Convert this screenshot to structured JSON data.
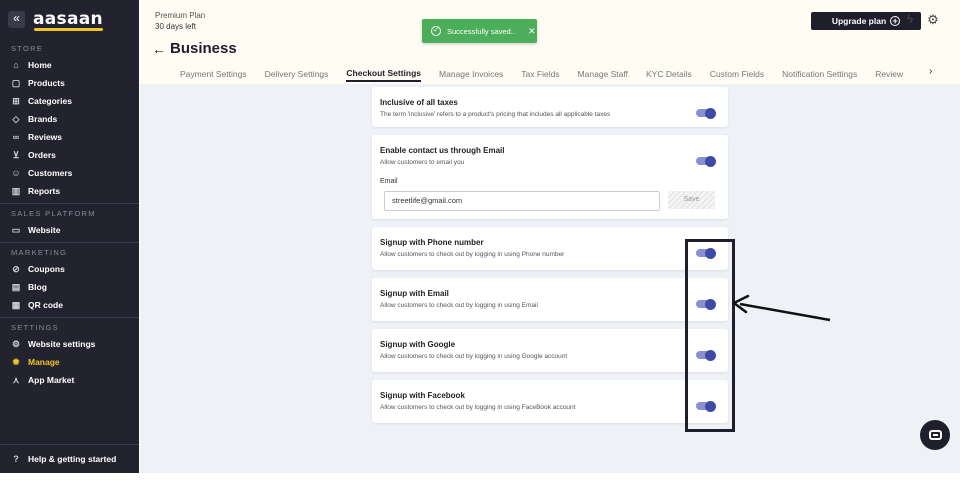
{
  "sidebar": {
    "collapse_icon": "«",
    "logo": "aasaan",
    "sections": [
      {
        "label": "STORE",
        "items": [
          {
            "label": "Home",
            "icon": "home-icon",
            "glyph": "⌂"
          },
          {
            "label": "Products",
            "icon": "products-icon",
            "glyph": "▢"
          },
          {
            "label": "Categories",
            "icon": "categories-icon",
            "glyph": "⊞"
          },
          {
            "label": "Brands",
            "icon": "tag-icon",
            "glyph": "◇"
          },
          {
            "label": "Reviews",
            "icon": "link-icon",
            "glyph": "∞"
          },
          {
            "label": "Orders",
            "icon": "cart-icon",
            "glyph": "⊻"
          },
          {
            "label": "Customers",
            "icon": "users-icon",
            "glyph": "☺"
          },
          {
            "label": "Reports",
            "icon": "bar-chart-icon",
            "glyph": "▥"
          }
        ]
      },
      {
        "label": "SALES PLATFORM",
        "items": [
          {
            "label": "Website",
            "icon": "monitor-icon",
            "glyph": "▭"
          }
        ]
      },
      {
        "label": "MARKETING",
        "items": [
          {
            "label": "Coupons",
            "icon": "coupon-icon",
            "glyph": "⊘"
          },
          {
            "label": "Blog",
            "icon": "blog-icon",
            "glyph": "▤"
          },
          {
            "label": "QR code",
            "icon": "qr-icon",
            "glyph": "▦"
          }
        ]
      },
      {
        "label": "SETTINGS",
        "items": [
          {
            "label": "Website settings",
            "icon": "website-settings-icon",
            "glyph": "⚙"
          },
          {
            "label": "Manage",
            "icon": "gear-icon",
            "glyph": "✹",
            "active": true
          },
          {
            "label": "App Market",
            "icon": "app-market-icon",
            "glyph": "⋏"
          }
        ]
      }
    ],
    "help": {
      "label": "Help & getting started",
      "icon": "help-icon",
      "glyph": "?"
    }
  },
  "header": {
    "plan": "Premium Plan",
    "days_left": "30 days left",
    "upgrade_label": "Upgrade plan",
    "page_title": "Business",
    "tabs": [
      "Payment Settings",
      "Delivery Settings",
      "Checkout Settings",
      "Manage Invoices",
      "Tax Fields",
      "Manage Staff",
      "KYC Details",
      "Custom Fields",
      "Notification Settings",
      "Review"
    ],
    "active_tab": "Checkout Settings"
  },
  "toast": {
    "message": "Successfully saved.."
  },
  "settings": {
    "taxes": {
      "title": "Inclusive of all taxes",
      "desc": "The term 'inclusive' refers to a product's pricing that includes all applicable taxes",
      "enabled": true
    },
    "contact_email": {
      "title": "Enable contact us through Email",
      "desc": "Allow customers to email you",
      "enabled": true,
      "email_label": "Email",
      "email_value": "streetlife@gmail.com",
      "save_label": "Save"
    },
    "signup_phone": {
      "title": "Signup with Phone number",
      "desc": "Allow customers to check out by logging in using Phone number",
      "enabled": true
    },
    "signup_email": {
      "title": "Signup with Email",
      "desc": "Allow customers to check out by logging in using Email",
      "enabled": true
    },
    "signup_google": {
      "title": "Signup with Google",
      "desc": "Allow customers to check out by logging in using Google account",
      "enabled": true
    },
    "signup_facebook": {
      "title": "Signup with Facebook",
      "desc": "Allow customers to check out by logging in using FaceBook account",
      "enabled": true
    }
  },
  "colors": {
    "sidebar_bg": "#23232f",
    "accent_yellow": "#f2c524",
    "toggle_on": "#3d4aa8",
    "toast_green": "#4cae5a"
  }
}
